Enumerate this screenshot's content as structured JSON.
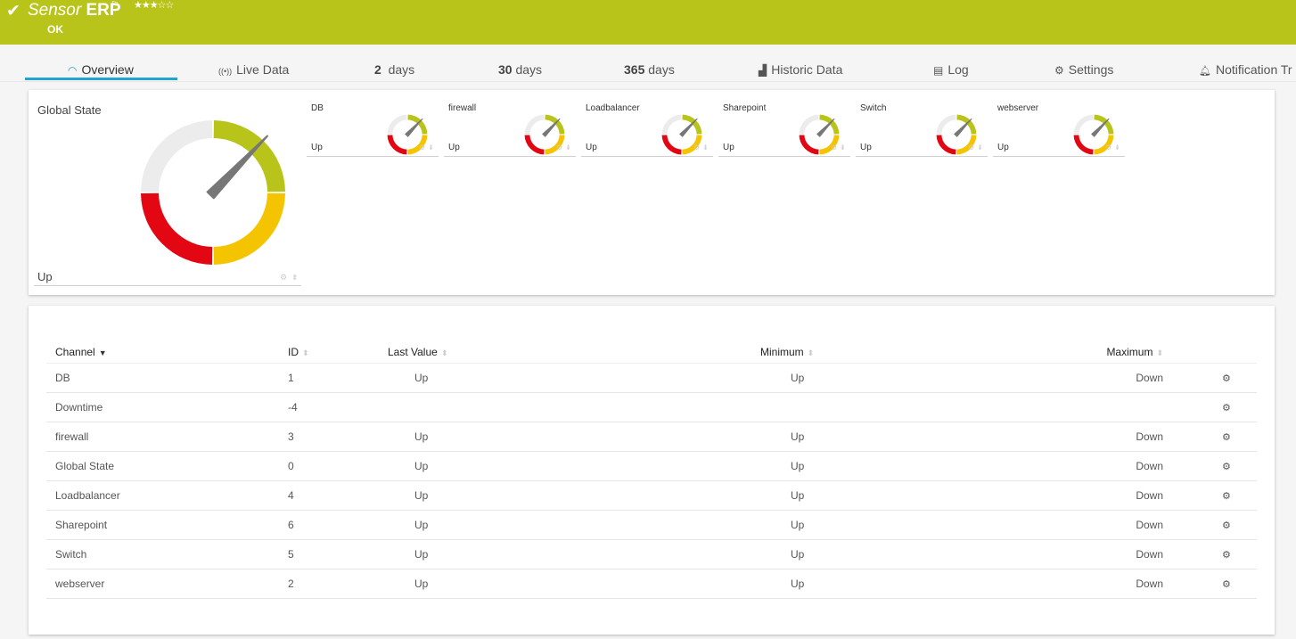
{
  "header": {
    "status_icon": "check-icon",
    "title_prefix": "Sensor",
    "title_name": "ERP",
    "flag_icon": "flag-icon",
    "priority_stars": 3,
    "priority_max": 5,
    "stars_text": "★★★☆☆",
    "status": "OK",
    "color": "#b9c41a"
  },
  "tabs": [
    {
      "label": "Overview",
      "icon": "gauge-icon",
      "glyph": "◠",
      "active": true
    },
    {
      "label": "Live Data",
      "icon": "broadcast-icon",
      "glyph": "((•))"
    },
    {
      "num": "2",
      "label": "days"
    },
    {
      "num": "30",
      "label": "days"
    },
    {
      "num": "365",
      "label": "days"
    },
    {
      "label": "Historic Data",
      "icon": "area-chart-icon",
      "glyph": "▟"
    },
    {
      "label": "Log",
      "icon": "list-icon",
      "glyph": "▤"
    },
    {
      "label": "Settings",
      "icon": "gear-icon",
      "glyph": "⚙"
    },
    {
      "label": "Notification Tr",
      "icon": "bell-icon",
      "glyph": "🔔"
    }
  ],
  "gauges": {
    "main": {
      "label": "Global State",
      "value": "Up"
    },
    "channels": [
      {
        "label": "DB",
        "value": "Up"
      },
      {
        "label": "firewall",
        "value": "Up"
      },
      {
        "label": "Loadbalancer",
        "value": "Up"
      },
      {
        "label": "Sharepoint",
        "value": "Up"
      },
      {
        "label": "Switch",
        "value": "Up"
      },
      {
        "label": "webserver",
        "value": "Up"
      }
    ],
    "segment_colors": {
      "up": "#b9c41a",
      "warning": "#f5c400",
      "down": "#e30613",
      "unknown": "#ececec",
      "needle": "#777777"
    },
    "tool_icons": {
      "gear": "⚙",
      "pin": "⇟"
    }
  },
  "table": {
    "headers": {
      "channel": "Channel",
      "id": "ID",
      "last": "Last Value",
      "min": "Minimum",
      "max": "Maximum"
    },
    "sort_active": "▼",
    "sort_idle": "⬍",
    "action_glyph": "⚙",
    "rows": [
      {
        "channel": "DB",
        "id": "1",
        "last": "Up",
        "min": "Up",
        "max": "Down"
      },
      {
        "channel": "Downtime",
        "id": "-4",
        "last": "",
        "min": "",
        "max": ""
      },
      {
        "channel": "firewall",
        "id": "3",
        "last": "Up",
        "min": "Up",
        "max": "Down"
      },
      {
        "channel": "Global State",
        "id": "0",
        "last": "Up",
        "min": "Up",
        "max": "Down"
      },
      {
        "channel": "Loadbalancer",
        "id": "4",
        "last": "Up",
        "min": "Up",
        "max": "Down"
      },
      {
        "channel": "Sharepoint",
        "id": "6",
        "last": "Up",
        "min": "Up",
        "max": "Down"
      },
      {
        "channel": "Switch",
        "id": "5",
        "last": "Up",
        "min": "Up",
        "max": "Down"
      },
      {
        "channel": "webserver",
        "id": "2",
        "last": "Up",
        "min": "Up",
        "max": "Down"
      }
    ]
  }
}
